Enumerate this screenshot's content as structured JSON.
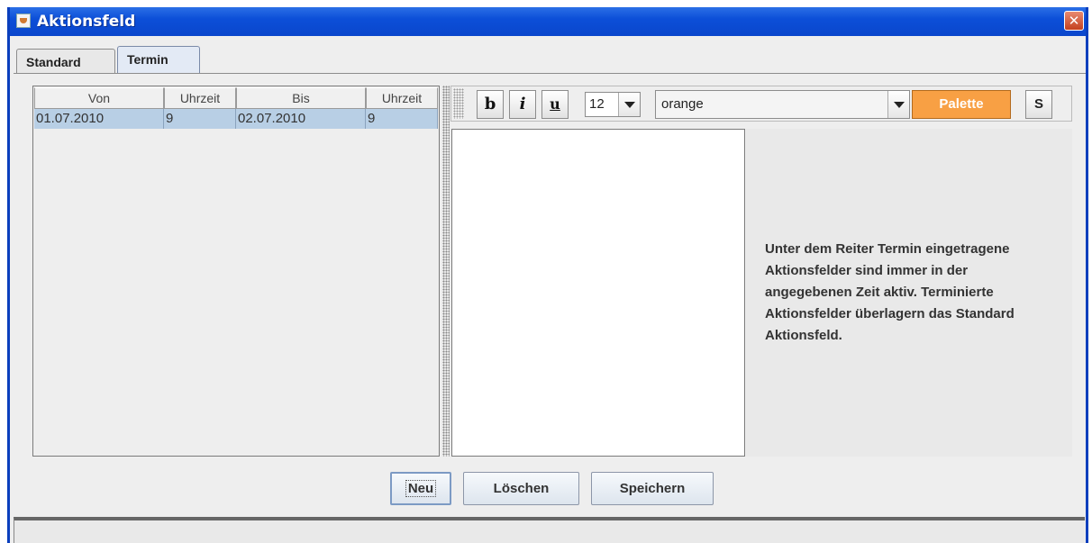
{
  "window": {
    "title": "Aktionsfeld",
    "close_label": "✕"
  },
  "tabs": [
    {
      "label": "Standard",
      "active": false
    },
    {
      "label": "Termin",
      "active": true
    }
  ],
  "table": {
    "columns": [
      "Von",
      "Uhrzeit",
      "Bis",
      "Uhrzeit"
    ],
    "rows": [
      [
        "01.07.2010",
        "9",
        "02.07.2010",
        "9"
      ]
    ],
    "selected_row": 0
  },
  "toolbar": {
    "bold_label": "b",
    "italic_label": "i",
    "underline_label": "u",
    "font_size": "12",
    "color_value": "orange",
    "palette_label": "Palette",
    "palette_color": "#f8a044",
    "s_label": "S"
  },
  "editor": {
    "content": ""
  },
  "info_text": "Unter dem Reiter Termin eingetragene Aktionsfelder sind immer in der angegebenen Zeit aktiv. Terminierte Aktionsfelder überlagern das Standard Aktionsfeld.",
  "buttons": {
    "new_label": "Neu",
    "delete_label": "Löschen",
    "save_label": "Speichern"
  },
  "colors": {
    "titlebar": "#0c4fd8",
    "selection": "#b8cfe5"
  }
}
